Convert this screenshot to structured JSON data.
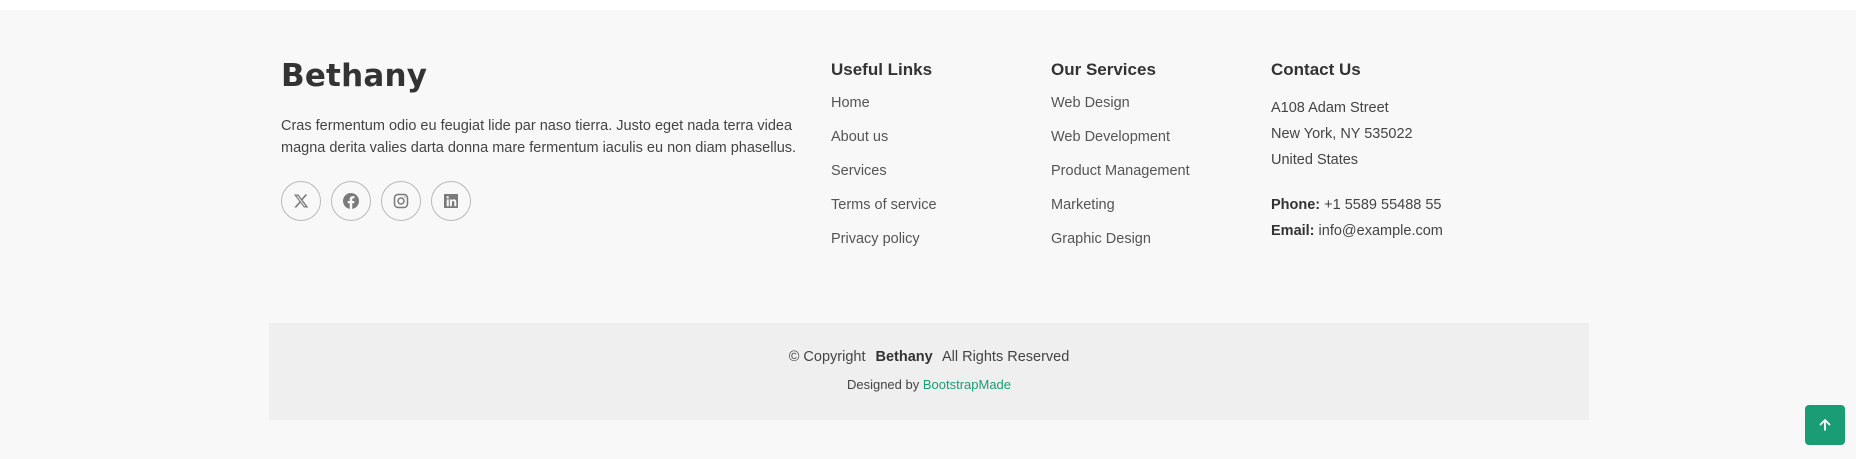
{
  "brand": {
    "name": "Bethany"
  },
  "about": {
    "text": "Cras fermentum odio eu feugiat lide par naso tierra. Justo eget nada terra videa magna derita valies darta donna mare fermentum iaculis eu non diam phasellus."
  },
  "socials": [
    {
      "icon": "x-twitter-icon"
    },
    {
      "icon": "facebook-icon"
    },
    {
      "icon": "instagram-icon"
    },
    {
      "icon": "linkedin-icon"
    }
  ],
  "useful_links": {
    "title": "Useful Links",
    "items": [
      "Home",
      "About us",
      "Services",
      "Terms of service",
      "Privacy policy"
    ]
  },
  "services": {
    "title": "Our Services",
    "items": [
      "Web Design",
      "Web Development",
      "Product Management",
      "Marketing",
      "Graphic Design"
    ]
  },
  "contact": {
    "title": "Contact Us",
    "address_line1": "A108 Adam Street",
    "address_line2": "New York, NY 535022",
    "address_line3": "United States",
    "phone_label": "Phone:",
    "phone_value": "+1 5589 55488 55",
    "email_label": "Email:",
    "email_value": "info@example.com"
  },
  "copyright": {
    "prefix": "© Copyright",
    "sitename": "Bethany",
    "suffix": "All Rights Reserved",
    "designed_by": "Designed by",
    "designer": "BootstrapMade"
  },
  "colors": {
    "accent": "#1a9c74",
    "footer_bg": "#f8f8f8",
    "band_bg": "#efefef"
  },
  "scroll_top": {
    "icon": "arrow-up-icon"
  }
}
